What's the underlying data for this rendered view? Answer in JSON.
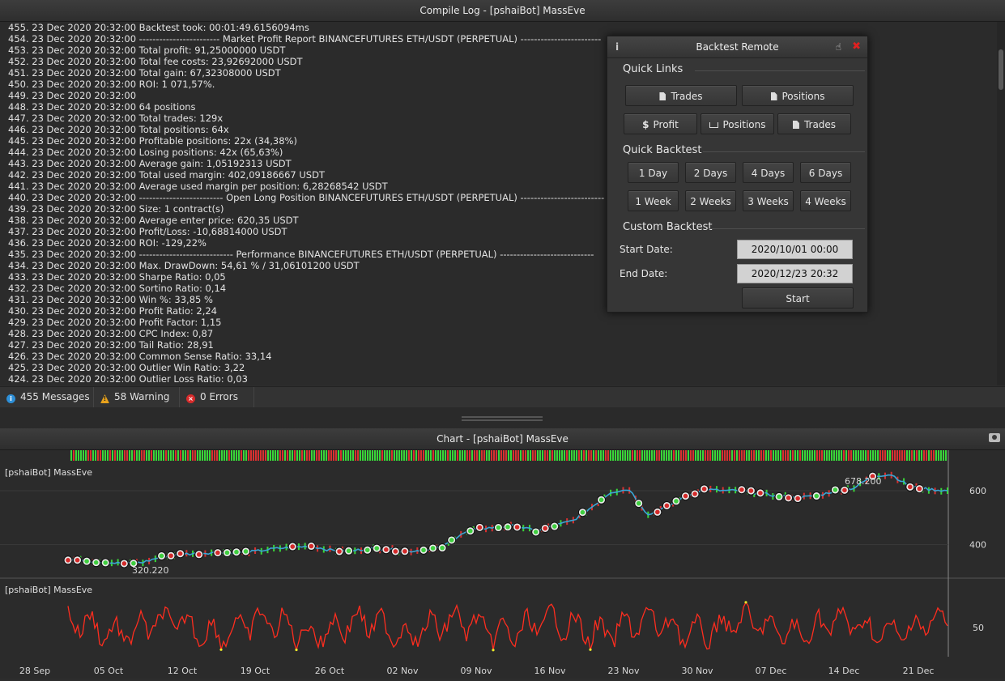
{
  "log_window": {
    "title": "Compile Log - [pshaiBot] MassEve",
    "lines": [
      "455. 23 Dec 2020 20:32:00 Backtest took: 00:01:49.6156094ms",
      "454. 23 Dec 2020 20:32:00 ------------------------ Market Profit Report BINANCEFUTURES ETH/USDT (PERPETUAL) ------------------------",
      "453. 23 Dec 2020 20:32:00 Total profit: 91,25000000 USDT",
      "452. 23 Dec 2020 20:32:00 Total fee costs: 23,92692000 USDT",
      "451. 23 Dec 2020 20:32:00 Total gain: 67,32308000 USDT",
      "450. 23 Dec 2020 20:32:00 ROI: 1 071,57%.",
      "449. 23 Dec 2020 20:32:00",
      "448. 23 Dec 2020 20:32:00 64 positions",
      "447. 23 Dec 2020 20:32:00 Total trades: 129x",
      "446. 23 Dec 2020 20:32:00 Total positions: 64x",
      "445. 23 Dec 2020 20:32:00 Profitable positions: 22x (34,38%)",
      "444. 23 Dec 2020 20:32:00 Losing positions: 42x (65,63%)",
      "443. 23 Dec 2020 20:32:00 Average gain: 1,05192313 USDT",
      "442. 23 Dec 2020 20:32:00 Total used margin: 402,09186667 USDT",
      "441. 23 Dec 2020 20:32:00 Average used margin per position: 6,28268542 USDT",
      "440. 23 Dec 2020 20:32:00 ------------------------- Open Long Position BINANCEFUTURES ETH/USDT (PERPETUAL) -------------------------",
      "439. 23 Dec 2020 20:32:00 Size: 1 contract(s)",
      "438. 23 Dec 2020 20:32:00 Average enter price: 620,35 USDT",
      "437. 23 Dec 2020 20:32:00 Profit/Loss: -10,68814000 USDT",
      "436. 23 Dec 2020 20:32:00 ROI: -129,22%",
      "435. 23 Dec 2020 20:32:00 ---------------------------- Performance BINANCEFUTURES ETH/USDT (PERPETUAL) ----------------------------",
      "434. 23 Dec 2020 20:32:00 Max. DrawDown: 54,61 % / 31,06101200 USDT",
      "433. 23 Dec 2020 20:32:00 Sharpe Ratio: 0,05",
      "432. 23 Dec 2020 20:32:00 Sortino Ratio: 0,14",
      "431. 23 Dec 2020 20:32:00 Win %: 33,85 %",
      "430. 23 Dec 2020 20:32:00 Profit Ratio: 2,24",
      "429. 23 Dec 2020 20:32:00 Profit Factor: 1,15",
      "428. 23 Dec 2020 20:32:00 CPC Index: 0,87",
      "427. 23 Dec 2020 20:32:00 Tail Ratio: 28,91",
      "426. 23 Dec 2020 20:32:00 Common Sense Ratio: 33,14",
      "425. 23 Dec 2020 20:32:00 Outlier Win Ratio: 3,22",
      "424. 23 Dec 2020 20:32:00 Outlier Loss Ratio: 0,03"
    ]
  },
  "statusbar": {
    "messages": "455 Messages",
    "warnings": "58 Warning",
    "errors": "0 Errors"
  },
  "backtest_remote": {
    "title": "Backtest Remote",
    "quick_links": {
      "label": "Quick Links",
      "row1": [
        "Trades",
        "Positions"
      ],
      "row2": [
        "Profit",
        "Positions",
        "Trades"
      ]
    },
    "quick_backtest": {
      "label": "Quick Backtest",
      "row1": [
        "1 Day",
        "2 Days",
        "4 Days",
        "6 Days"
      ],
      "row2": [
        "1 Week",
        "2 Weeks",
        "3 Weeks",
        "4 Weeks"
      ]
    },
    "custom_backtest": {
      "label": "Custom Backtest",
      "start_label": "Start Date:",
      "start_value": "2020/10/01 00:00",
      "end_label": "End Date:",
      "end_value": "2020/12/23 20:32",
      "start_button": "Start"
    }
  },
  "chart_window": {
    "title": "Chart - [pshaiBot] MassEve",
    "price_pane_label": "[pshaiBot] MassEve",
    "oscillator_pane_label": "[pshaiBot] MassEve",
    "high_annotation": "678.200",
    "low_annotation": "320.220"
  },
  "chart_data": [
    {
      "type": "line",
      "series": [
        {
          "values": [
            345,
            340,
            335,
            330,
            335,
            355,
            365,
            368,
            372,
            370,
            375,
            385,
            390,
            395,
            380,
            375,
            385,
            385,
            375,
            380,
            390,
            440,
            460,
            465,
            470,
            450,
            470,
            490,
            540,
            595,
            605,
            510,
            540,
            580,
            605,
            600,
            600,
            590,
            580,
            575,
            580,
            600,
            610,
            655,
            660,
            615,
            605,
            600
          ]
        }
      ],
      "x_ticks": [
        "28 Sep",
        "05 Oct",
        "12 Oct",
        "19 Oct",
        "26 Oct",
        "02 Nov",
        "09 Nov",
        "16 Nov",
        "23 Nov",
        "30 Nov",
        "07 Dec",
        "14 Dec",
        "21 Dec"
      ],
      "y_ticks": [
        400,
        600
      ],
      "ylim": [
        300,
        720
      ],
      "colors": {
        "line": "#3aa6d6",
        "entry_marker": "#e8e8e8",
        "loss_marker": "#d42a2a",
        "win_marker": "#3fcf3f",
        "up_bar": "#39d639",
        "down_bar": "#d93030"
      }
    },
    {
      "type": "line",
      "y_ticks": [
        50
      ],
      "colors": {
        "line": "#ff2d1f",
        "highlight": "#e8e82a"
      }
    }
  ]
}
